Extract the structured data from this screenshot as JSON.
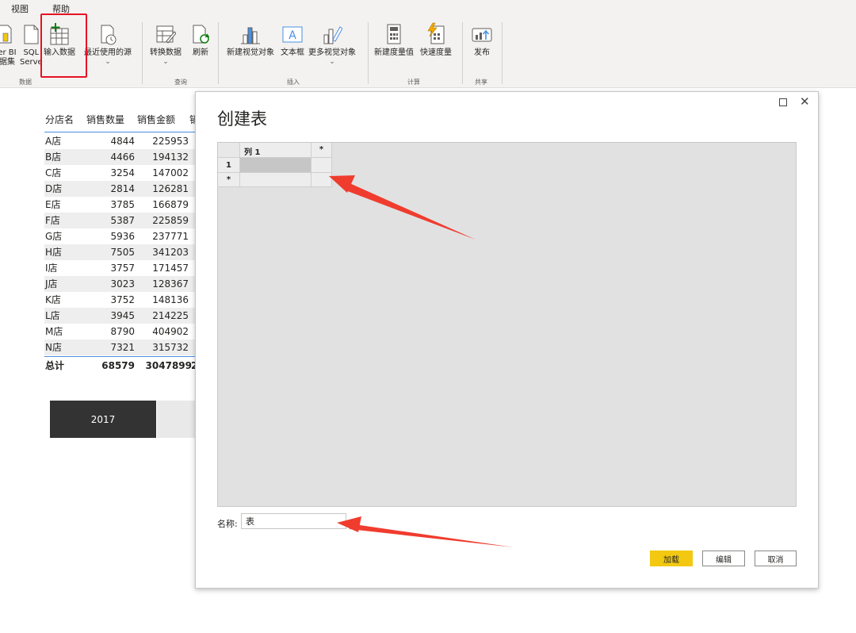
{
  "menu": {
    "view": "视图",
    "help": "帮助"
  },
  "ribbon": {
    "powerbi_partial_1": "er BI",
    "powerbi_partial_2": "据集",
    "sql_1": "SQL",
    "sql_2": "Serve",
    "enter_data": "输入数据",
    "recent_sources": "最近使用的源",
    "transform": "转换数据",
    "refresh": "刷新",
    "new_visual": "新建视觉对象",
    "textbox": "文本框",
    "more_visuals": "更多视觉对象",
    "new_measure": "新建度量值",
    "quick_measure": "快速度量",
    "publish": "发布",
    "groups": {
      "data": "数据",
      "query": "查询",
      "insert": "插入",
      "calc": "计算",
      "share": "共享"
    },
    "chevron": "⌄"
  },
  "report_table": {
    "headers": [
      "分店名",
      "销售数量",
      "销售金额",
      "销"
    ],
    "rows": [
      [
        "A店",
        "4844",
        "225953"
      ],
      [
        "B店",
        "4466",
        "194132"
      ],
      [
        "C店",
        "3254",
        "147002"
      ],
      [
        "D店",
        "2814",
        "126281"
      ],
      [
        "E店",
        "3785",
        "166879"
      ],
      [
        "F店",
        "5387",
        "225859"
      ],
      [
        "G店",
        "5936",
        "237771"
      ],
      [
        "H店",
        "7505",
        "341203"
      ],
      [
        "I店",
        "3757",
        "171457"
      ],
      [
        "J店",
        "3023",
        "128367"
      ],
      [
        "K店",
        "3752",
        "148136"
      ],
      [
        "L店",
        "3945",
        "214225"
      ],
      [
        "M店",
        "8790",
        "404902"
      ],
      [
        "N店",
        "7321",
        "315732"
      ]
    ],
    "total": [
      "总计",
      "68579",
      "3047899",
      "2"
    ]
  },
  "slicer": {
    "label": "2017"
  },
  "dialog": {
    "title": "创建表",
    "grid": {
      "column_header": "列 1",
      "add_column": "*",
      "row_number": "1",
      "new_row": "*"
    },
    "name_label": "名称:",
    "name_value": "表",
    "buttons": {
      "load": "加载",
      "edit": "编辑",
      "cancel": "取消"
    },
    "close_glyph": "✕"
  },
  "colors": {
    "primary_button": "#f2c811",
    "highlight": "#e81123",
    "arrow": "#f03c2e"
  }
}
